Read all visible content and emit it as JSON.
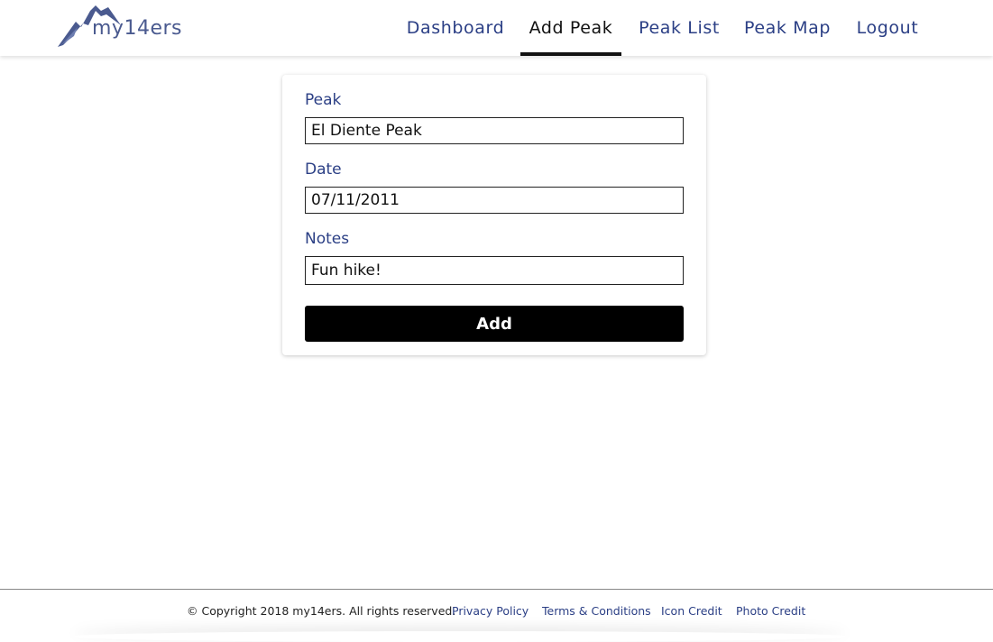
{
  "brand": {
    "logo_text": "my14ers",
    "logo_icon": "mountain-icon",
    "color": "#4a5a8f"
  },
  "nav": {
    "items": [
      {
        "label": "Dashboard",
        "active": false
      },
      {
        "label": "Add Peak",
        "active": true
      },
      {
        "label": "Peak List",
        "active": false
      },
      {
        "label": "Peak Map",
        "active": false
      },
      {
        "label": "Logout",
        "active": false
      }
    ],
    "link_color": "#2b3f85",
    "active_color": "#111111"
  },
  "form": {
    "peak_label": "Peak",
    "peak_value": "El Diente Peak",
    "date_label": "Date",
    "date_value": "07/11/2011",
    "notes_label": "Notes",
    "notes_value": "Fun hike!",
    "submit_label": "Add"
  },
  "footer": {
    "copyright": "© Copyright 2018 my14ers. All rights reserved.",
    "links": [
      "Privacy Policy",
      "Terms & Conditions",
      "Icon Credit",
      "Photo Credit"
    ]
  }
}
